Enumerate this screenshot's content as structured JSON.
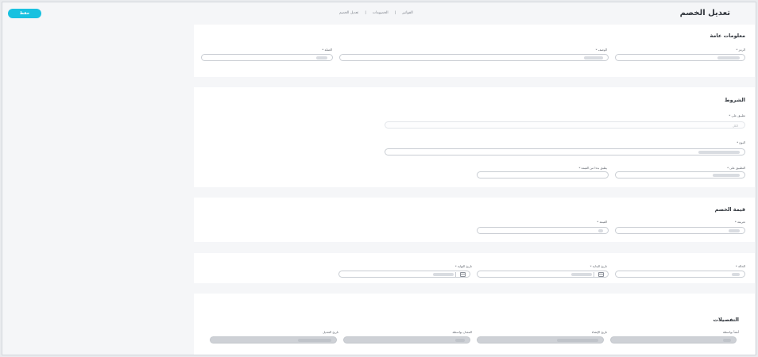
{
  "header": {
    "title": "تعديل الخصم",
    "save_label": "حفظ",
    "breadcrumb": [
      "الفواتير",
      "الخصومات",
      "تعديل الخصم"
    ],
    "breadcrumb_separator": "|"
  },
  "general": {
    "title": "معلومات عامة",
    "fields": [
      {
        "label": "الرمز *"
      },
      {
        "label": "الوصف *"
      },
      {
        "label": "العملة *"
      }
    ]
  },
  "conditions": {
    "title": "الشروط",
    "apply_on_label": "تطبيق على *",
    "apply_on_placeholder": "الكل",
    "type_label": "النوع *",
    "applied_on_label": "التطبيق على *",
    "applied_from_label": "يطبق بدءا من القيمة *"
  },
  "discount_value": {
    "title": "قيمة الخصم",
    "type_label": "تعريفة *",
    "value_label": "القيمة *"
  },
  "validity": {
    "status_label": "الحالة *",
    "start_date_label": "تاريخ البداية *",
    "end_date_label": "تاريخ النهاية *"
  },
  "details": {
    "title": "التفصيلات",
    "created_by_label": "أنشأ بواسطة",
    "created_at_label": "تاريخ الإنشاء",
    "modified_by_label": "المعدل بواسطة",
    "modified_at_label": "تاريخ التعديل"
  },
  "colors": {
    "accent": "#18c1e0",
    "background": "#f5f6f8",
    "card": "#ffffff"
  }
}
